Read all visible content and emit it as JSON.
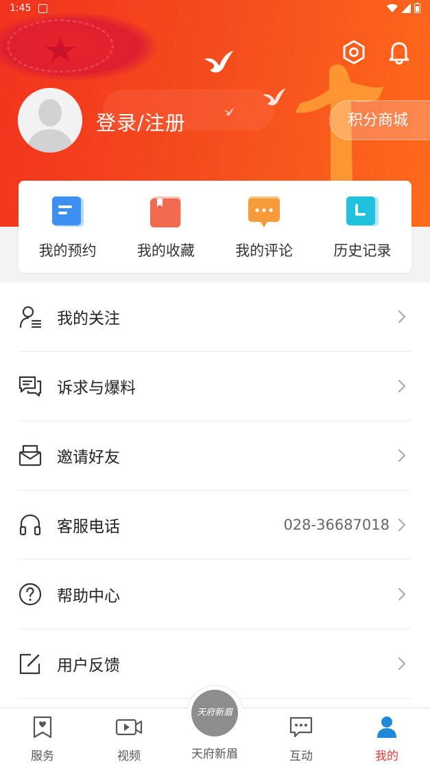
{
  "status_bar": {
    "time": "1:45"
  },
  "header": {
    "login_label": "登录/注册",
    "mall_button": "积分商城"
  },
  "quick_actions": [
    {
      "label": "我的预约",
      "icon": "appointment-icon",
      "color": "#3d8ff0"
    },
    {
      "label": "我的收藏",
      "icon": "favorites-icon",
      "color": "#f26a4f"
    },
    {
      "label": "我的评论",
      "icon": "comment-icon",
      "color": "#f79b3a"
    },
    {
      "label": "历史记录",
      "icon": "history-icon",
      "color": "#1fc1dc"
    }
  ],
  "menu": [
    {
      "label": "我的关注",
      "icon": "user-follow-icon",
      "value": ""
    },
    {
      "label": "诉求与爆料",
      "icon": "chat-report-icon",
      "value": ""
    },
    {
      "label": "邀请好友",
      "icon": "invite-mail-icon",
      "value": ""
    },
    {
      "label": "客服电话",
      "icon": "headset-icon",
      "value": "028-36687018"
    },
    {
      "label": "帮助中心",
      "icon": "help-icon",
      "value": ""
    },
    {
      "label": "用户反馈",
      "icon": "feedback-edit-icon",
      "value": ""
    }
  ],
  "bottom_nav": {
    "items": [
      {
        "label": "服务",
        "icon": "service-icon"
      },
      {
        "label": "视频",
        "icon": "video-icon"
      },
      {
        "label": "天府新眉",
        "icon": "tianfu-logo-icon"
      },
      {
        "label": "互动",
        "icon": "interact-icon"
      },
      {
        "label": "我的",
        "icon": "profile-icon"
      }
    ],
    "center_logo_text": "天府新眉",
    "active_color": "#e53935"
  }
}
